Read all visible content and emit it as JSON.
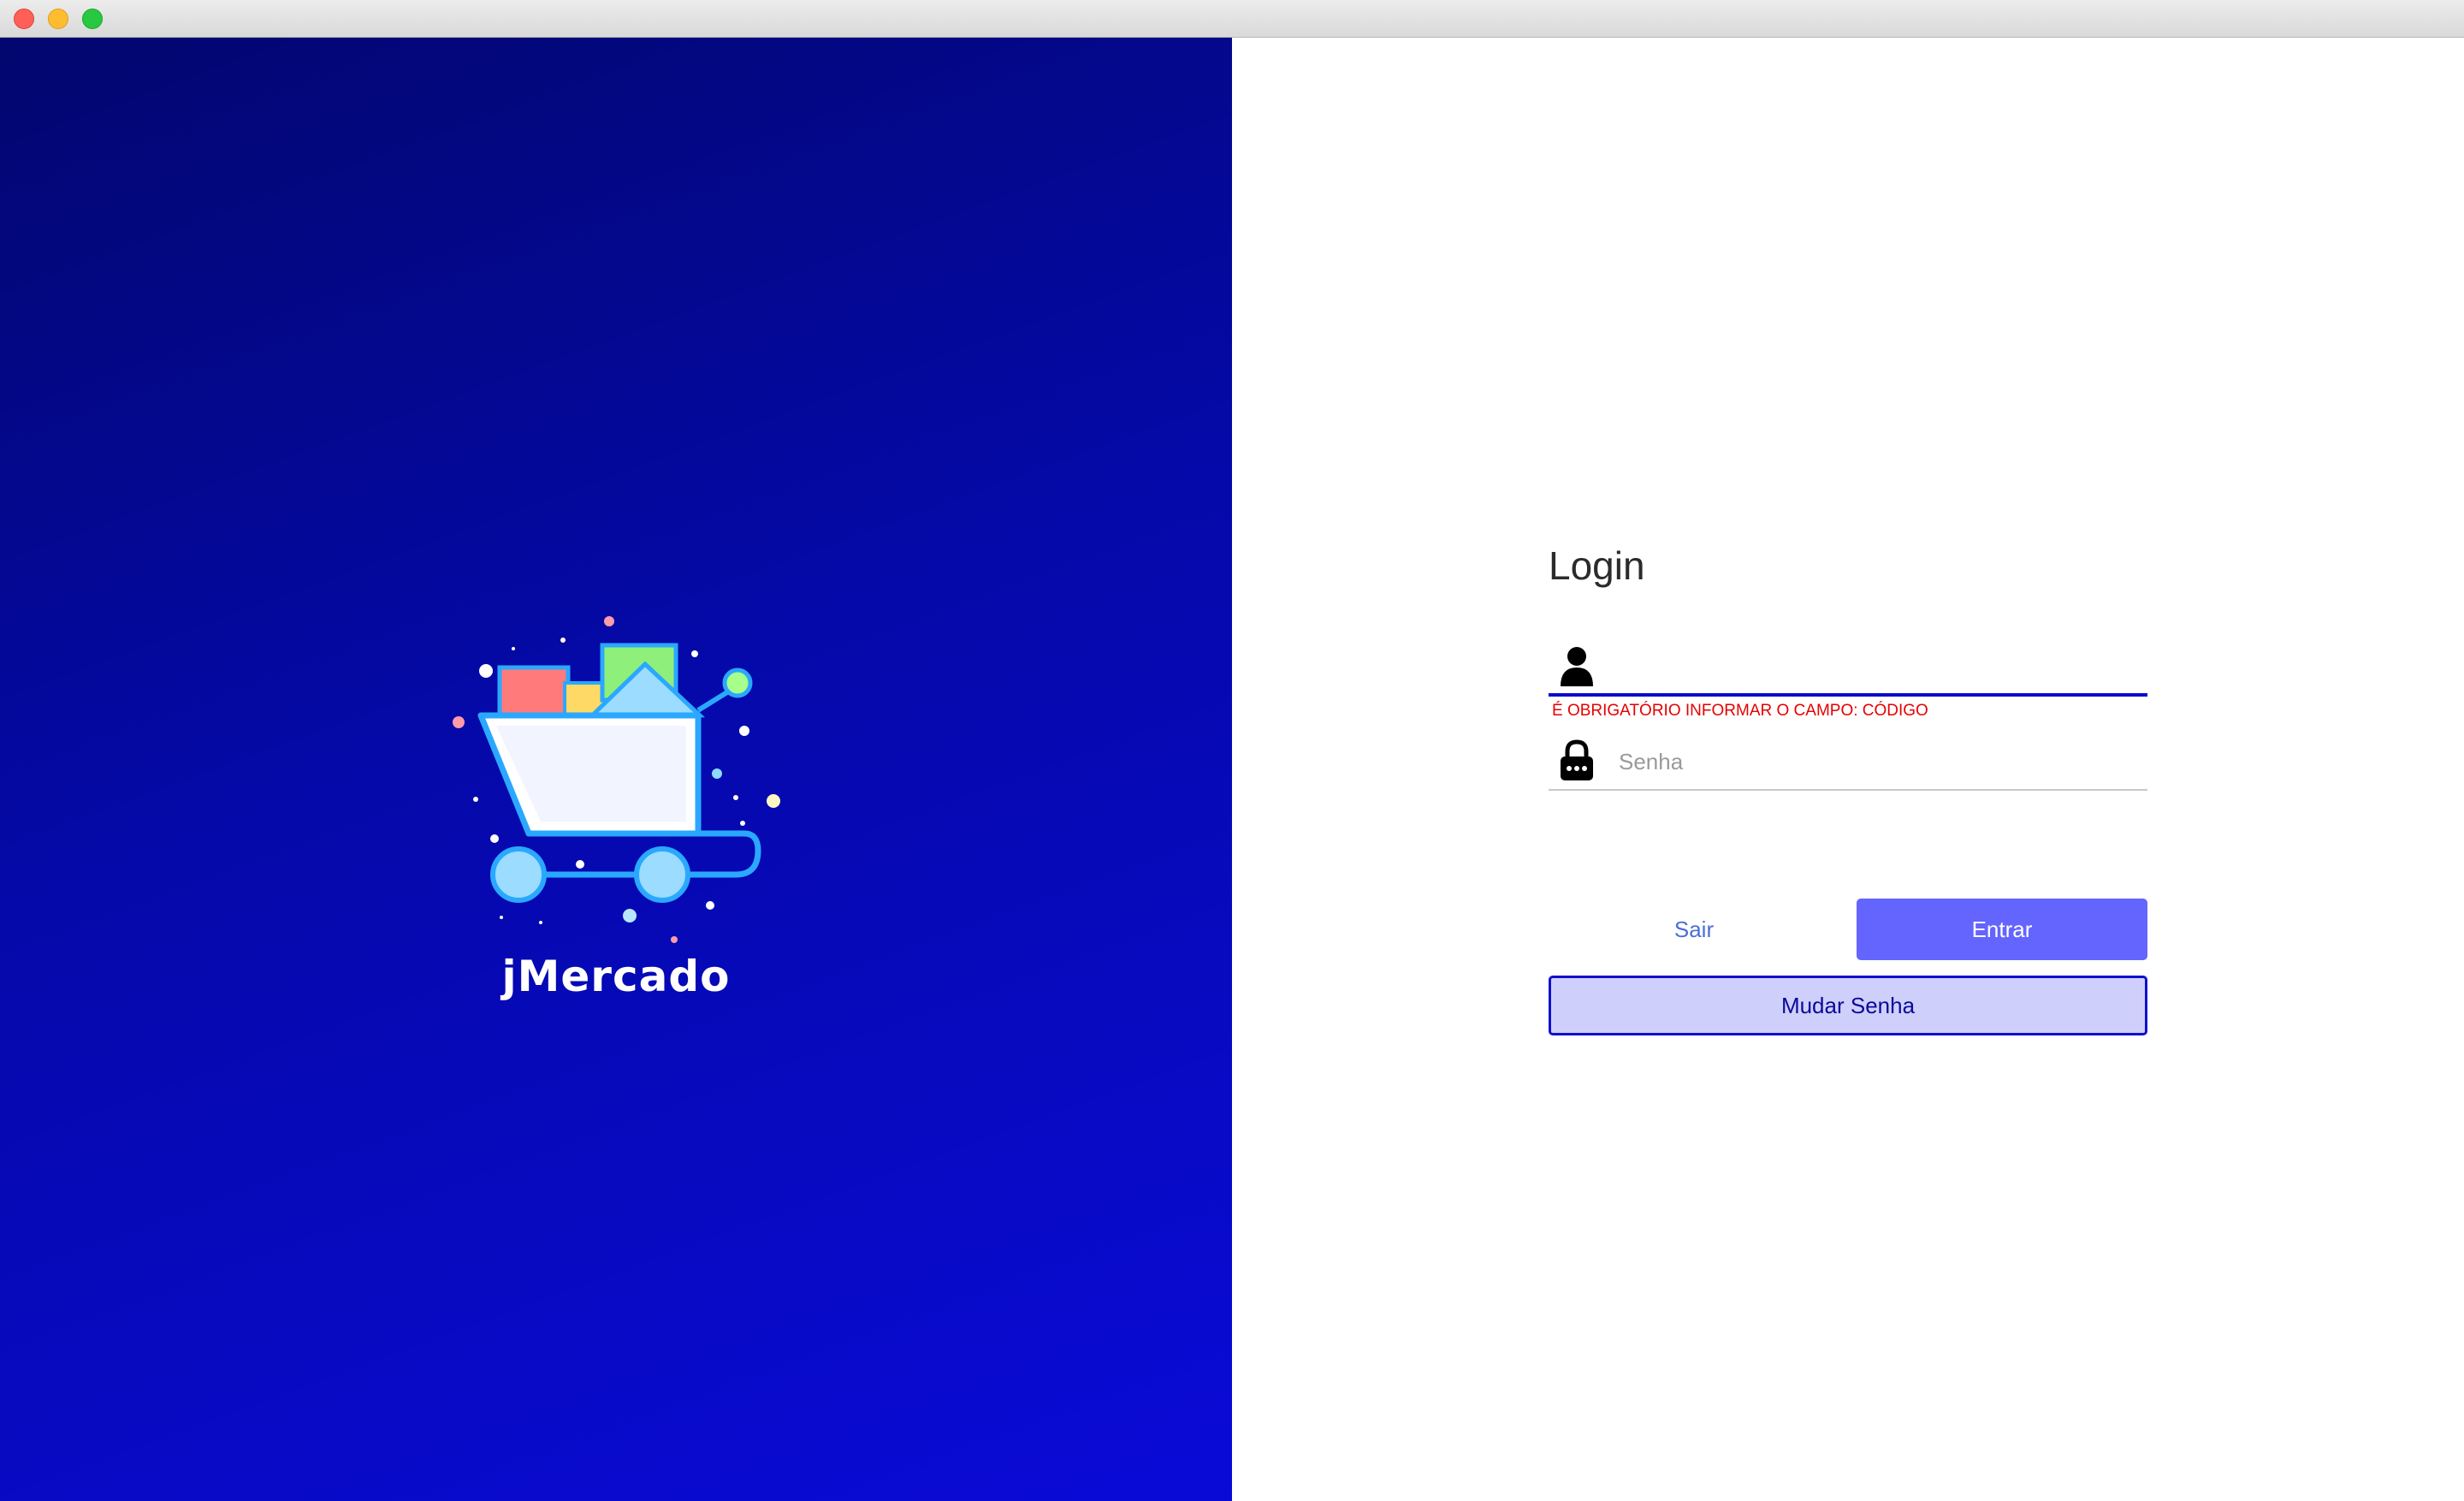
{
  "window": {
    "controls": [
      "close-button",
      "minimize-button",
      "zoom-button"
    ]
  },
  "branding": {
    "app_name": "jMercado",
    "logo_icon": "shopping-cart-icon",
    "background_colors": [
      "#02066e",
      "#0a0ad8"
    ]
  },
  "login": {
    "title": "Login",
    "user_field": {
      "icon": "user-icon",
      "value": "",
      "placeholder": "",
      "error": "É OBRIGATÓRIO INFORMAR O CAMPO: CÓDIGO"
    },
    "password_field": {
      "icon": "lock-icon",
      "value": "",
      "placeholder": "Senha"
    },
    "buttons": {
      "exit_label": "Sair",
      "enter_label": "Entrar",
      "change_password_label": "Mudar Senha"
    },
    "colors": {
      "accent": "#6464ff",
      "error": "#e60000",
      "focus_underline": "#0a0ad0",
      "secondary_button_bg": "#cfcffb"
    }
  }
}
